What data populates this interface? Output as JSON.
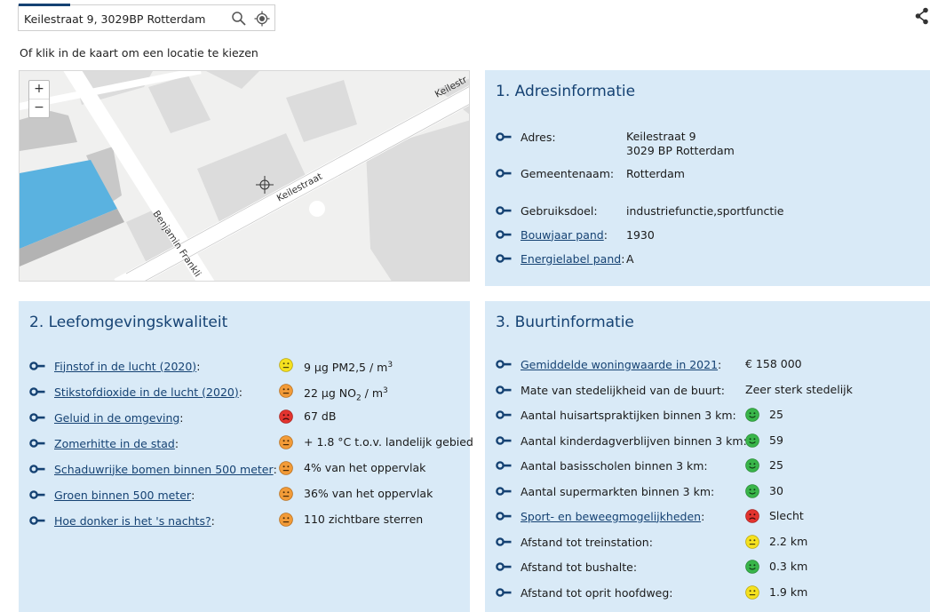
{
  "search": {
    "value": "Keilestraat 9, 3029BP Rotterdam",
    "search_icon": "search-icon",
    "locate_icon": "locate-icon"
  },
  "share_icon": "share-icon",
  "hint": "Of klik in de kaart om een locatie te kiezen",
  "map": {
    "zoom_in": "+",
    "zoom_out": "−",
    "street1": "Keilestraat",
    "street2": "Keilestr",
    "street3": "Benjamin Frankli"
  },
  "adres": {
    "title": "1. Adresinformatie",
    "rows": [
      {
        "label": "Adres:",
        "value1": "Keilestraat 9",
        "value2": "3029 BP  Rotterdam"
      },
      {
        "label": "Gemeentenaam:",
        "value": "Rotterdam"
      },
      {
        "label": "Gebruiksdoel:",
        "value": "industriefunctie,sportfunctie"
      },
      {
        "label": "Bouwjaar pand",
        "suffix": ":",
        "value": "1930"
      },
      {
        "label": "Energielabel pand",
        "suffix": ":",
        "value": "A"
      }
    ]
  },
  "leef": {
    "title": "2. Leefomgevingskwaliteit",
    "rows": [
      {
        "label": "Fijnstof in de lucht (2020)",
        "suffix": ":",
        "rating": "neutral-yellow",
        "value": "9 µg PM2,5 / m",
        "sup": "3"
      },
      {
        "label": "Stikstofdioxide in de lucht (2020)",
        "suffix": ":",
        "rating": "neutral-orange",
        "value_pre": "22 µg NO",
        "sub": "2",
        "value_post": " / m",
        "sup": "3"
      },
      {
        "label": "Geluid in de omgeving",
        "suffix": ":",
        "rating": "sad-red",
        "value": "67 dB"
      },
      {
        "label": "Zomerhitte in de stad",
        "suffix": ":",
        "rating": "neutral-orange",
        "value": "+ 1.8 °C t.o.v. landelijk gebied"
      },
      {
        "label": "Schaduwrijke bomen binnen 500 meter",
        "suffix": ":",
        "rating": "neutral-orange",
        "value": "4% van het oppervlak"
      },
      {
        "label": "Groen binnen 500 meter",
        "suffix": ":",
        "rating": "neutral-orange",
        "value": "36% van het oppervlak"
      },
      {
        "label": "Hoe donker is het 's nachts?",
        "suffix": ":",
        "rating": "neutral-orange",
        "value": "110 zichtbare sterren"
      }
    ]
  },
  "buurt": {
    "title": "3. Buurtinformatie",
    "rows": [
      {
        "label": "Gemiddelde woningwaarde in 2021",
        "suffix": ":",
        "link": true,
        "value": "€ 158 000"
      },
      {
        "label": "Mate van stedelijkheid van de buurt:",
        "value": "Zeer sterk stedelijk"
      },
      {
        "label": "Aantal huisartspraktijken binnen 3 km:",
        "rating": "happy-green",
        "value": "25"
      },
      {
        "label": "Aantal kinderdagverblijven binnen 3 km:",
        "rating": "happy-green",
        "value": "59"
      },
      {
        "label": "Aantal basisscholen binnen 3 km:",
        "rating": "happy-green",
        "value": "25"
      },
      {
        "label": "Aantal supermarkten binnen 3 km:",
        "rating": "happy-green",
        "value": "30"
      },
      {
        "label": "Sport- en beweegmogelijkheden",
        "suffix": ":",
        "link": true,
        "rating": "sad-red",
        "value": "Slecht"
      },
      {
        "label": "Afstand tot treinstation:",
        "rating": "neutral-yellow",
        "value": "2.2 km"
      },
      {
        "label": "Afstand tot bushalte:",
        "rating": "happy-green",
        "value": "0.3 km"
      },
      {
        "label": "Afstand tot oprit hoofdweg:",
        "rating": "neutral-yellow",
        "value": "1.9 km"
      }
    ]
  },
  "colors": {
    "panel_bg": "#d9eaf7",
    "title": "#154273",
    "bullet": "#154273",
    "green": "#39b54a",
    "yellow": "#f5e11f",
    "orange": "#f29b38",
    "red": "#e3342f"
  }
}
